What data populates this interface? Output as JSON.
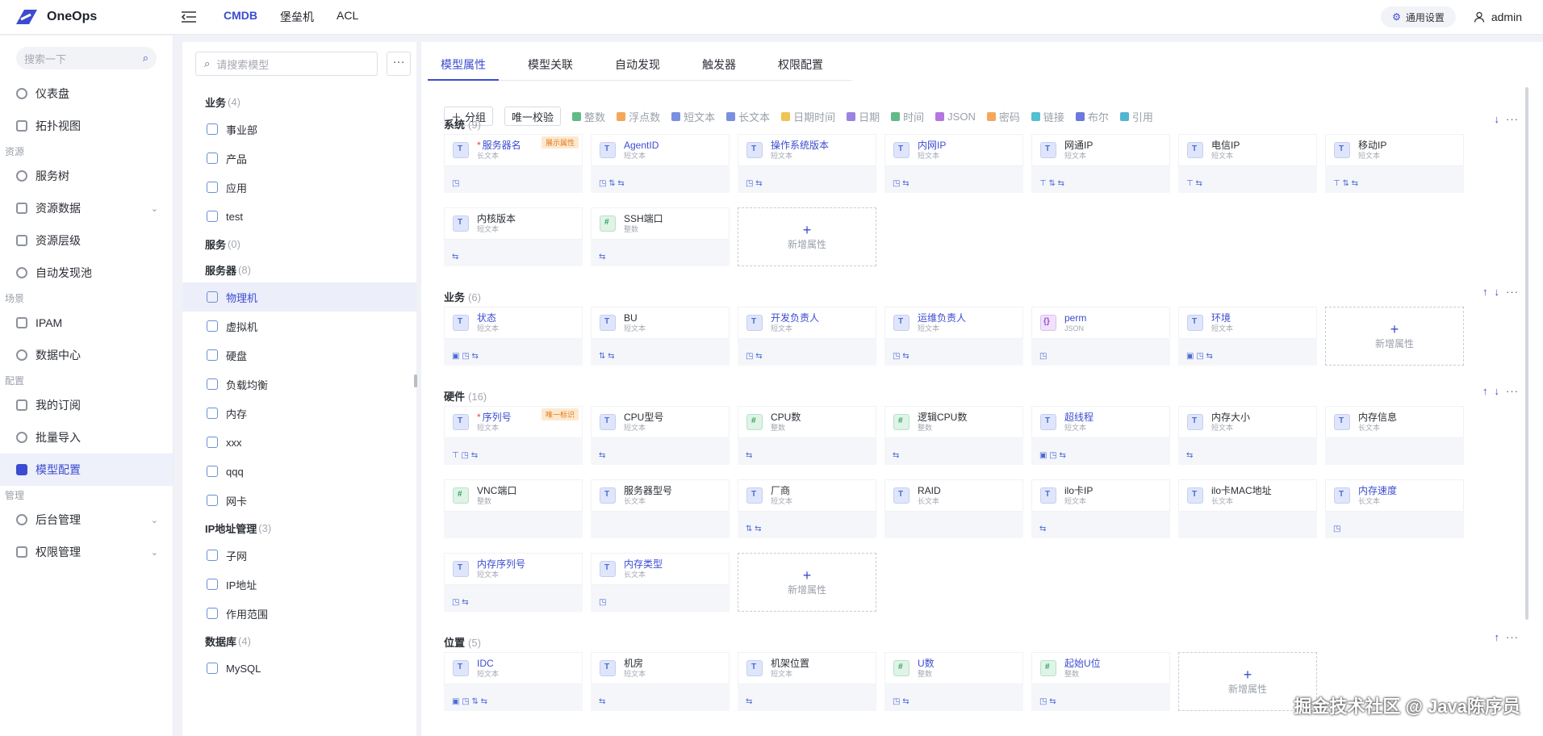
{
  "app": {
    "name": "OneOps"
  },
  "topnav": [
    {
      "label": "CMDB",
      "active": true
    },
    {
      "label": "堡垒机"
    },
    {
      "label": "ACL"
    }
  ],
  "header": {
    "settings_label": "通用设置",
    "user": "admin"
  },
  "sidebar": {
    "search_placeholder": "搜索一下",
    "items": [
      {
        "type": "item",
        "label": "仪表盘",
        "icon": "dashboard-icon"
      },
      {
        "type": "item",
        "label": "拓扑视图",
        "icon": "topology-icon"
      },
      {
        "type": "group",
        "label": "资源"
      },
      {
        "type": "item",
        "label": "服务树",
        "icon": "tree-icon"
      },
      {
        "type": "item",
        "label": "资源数据",
        "icon": "data-icon",
        "expand": true
      },
      {
        "type": "item",
        "label": "资源层级",
        "icon": "layers-icon"
      },
      {
        "type": "item",
        "label": "自动发现池",
        "icon": "discover-icon"
      },
      {
        "type": "group",
        "label": "场景"
      },
      {
        "type": "item",
        "label": "IPAM",
        "icon": "ipam-icon"
      },
      {
        "type": "item",
        "label": "数据中心",
        "icon": "datacenter-icon"
      },
      {
        "type": "group",
        "label": "配置"
      },
      {
        "type": "item",
        "label": "我的订阅",
        "icon": "bookmark-icon"
      },
      {
        "type": "item",
        "label": "批量导入",
        "icon": "import-icon"
      },
      {
        "type": "item",
        "label": "模型配置",
        "icon": "model-icon",
        "active": true
      },
      {
        "type": "group",
        "label": "管理"
      },
      {
        "type": "item",
        "label": "后台管理",
        "icon": "admin-icon",
        "expand": true
      },
      {
        "type": "item",
        "label": "权限管理",
        "icon": "shield-icon",
        "expand": true
      }
    ]
  },
  "tree": {
    "search_placeholder": "请搜索模型",
    "more": "···",
    "nodes": [
      {
        "type": "group",
        "label": "业务",
        "count": "(4)"
      },
      {
        "type": "item",
        "label": "事业部"
      },
      {
        "type": "item",
        "label": "产品"
      },
      {
        "type": "item",
        "label": "应用"
      },
      {
        "type": "item",
        "label": "test"
      },
      {
        "type": "group",
        "label": "服务",
        "count": "(0)"
      },
      {
        "type": "group",
        "label": "服务器",
        "count": "(8)"
      },
      {
        "type": "item",
        "label": "物理机",
        "selected": true
      },
      {
        "type": "item",
        "label": "虚拟机"
      },
      {
        "type": "item",
        "label": "硬盘"
      },
      {
        "type": "item",
        "label": "负载均衡"
      },
      {
        "type": "item",
        "label": "内存"
      },
      {
        "type": "item",
        "label": "xxx"
      },
      {
        "type": "item",
        "label": "qqq"
      },
      {
        "type": "item",
        "label": "网卡"
      },
      {
        "type": "group",
        "label": "IP地址管理",
        "count": "(3)"
      },
      {
        "type": "item",
        "label": "子网"
      },
      {
        "type": "item",
        "label": "IP地址"
      },
      {
        "type": "item",
        "label": "作用范围"
      },
      {
        "type": "group",
        "label": "数据库",
        "count": "(4)"
      },
      {
        "type": "item",
        "label": "MySQL"
      }
    ]
  },
  "tabs": [
    {
      "label": "模型属性",
      "active": true
    },
    {
      "label": "模型关联"
    },
    {
      "label": "自动发现"
    },
    {
      "label": "触发器"
    },
    {
      "label": "权限配置"
    }
  ],
  "toolbar": {
    "group_btn": "分组",
    "unique_btn": "唯一校验",
    "field_types": [
      {
        "label": "整数",
        "color": "#2ea35e"
      },
      {
        "label": "浮点数",
        "color": "#f08a24"
      },
      {
        "label": "短文本",
        "color": "#4c6bd6"
      },
      {
        "label": "长文本",
        "color": "#4c6bd6"
      },
      {
        "label": "日期时间",
        "color": "#e8b21c"
      },
      {
        "label": "日期",
        "color": "#7a5ad6"
      },
      {
        "label": "时间",
        "color": "#2ea35e"
      },
      {
        "label": "JSON",
        "color": "#9b4ad6"
      },
      {
        "label": "密码",
        "color": "#f08a24"
      },
      {
        "label": "链接",
        "color": "#1aa9c1"
      },
      {
        "label": "布尔",
        "color": "#3b4cd0"
      },
      {
        "label": "引用",
        "color": "#1a9ec1"
      }
    ]
  },
  "add_label": "新增属性",
  "sections": [
    {
      "name": "系统",
      "count": "(9)",
      "up": false,
      "down": true,
      "fields": [
        {
          "name": "服务器名",
          "type": "长文本",
          "required": true,
          "badge": "展示属性",
          "blue": true,
          "icons": "◳"
        },
        {
          "name": "AgentID",
          "type": "短文本",
          "blue": true,
          "icons": "◳ ⇅ ⇆"
        },
        {
          "name": "操作系统版本",
          "type": "短文本",
          "blue": true,
          "icons": "◳ ⇆"
        },
        {
          "name": "内网IP",
          "type": "短文本",
          "blue": true,
          "icons": "◳ ⇆"
        },
        {
          "name": "网通IP",
          "type": "短文本",
          "icons": "⊤ ⇅ ⇆"
        },
        {
          "name": "电信IP",
          "type": "短文本",
          "icons": "⊤ ⇆"
        },
        {
          "name": "移动IP",
          "type": "短文本",
          "icons": "⊤ ⇅ ⇆"
        },
        {
          "name": "内核版本",
          "type": "短文本",
          "icons": "⇆"
        },
        {
          "name": "SSH端口",
          "type": "整数",
          "kind": "num",
          "icons": "⇆"
        }
      ]
    },
    {
      "name": "业务",
      "count": "(6)",
      "up": true,
      "down": true,
      "fields": [
        {
          "name": "状态",
          "type": "短文本",
          "blue": true,
          "icons": "▣ ◳ ⇆"
        },
        {
          "name": "BU",
          "type": "短文本",
          "icons": "⇅ ⇆"
        },
        {
          "name": "开发负责人",
          "type": "短文本",
          "blue": true,
          "icons": "◳ ⇆"
        },
        {
          "name": "运维负责人",
          "type": "短文本",
          "blue": true,
          "icons": "◳ ⇆"
        },
        {
          "name": "perm",
          "type": "JSON",
          "kind": "json",
          "blue": true,
          "icons": "◳"
        },
        {
          "name": "环境",
          "type": "短文本",
          "blue": true,
          "icons": "▣ ◳ ⇆"
        }
      ]
    },
    {
      "name": "硬件",
      "count": "(16)",
      "up": true,
      "down": true,
      "fields": [
        {
          "name": "序列号",
          "type": "短文本",
          "required": true,
          "badge": "唯一标识",
          "blue": true,
          "icons": "⊤ ◳ ⇆"
        },
        {
          "name": "CPU型号",
          "type": "短文本",
          "icons": "⇆"
        },
        {
          "name": "CPU数",
          "type": "整数",
          "kind": "num",
          "icons": "⇆"
        },
        {
          "name": "逻辑CPU数",
          "type": "整数",
          "kind": "num",
          "icons": "⇆"
        },
        {
          "name": "超线程",
          "type": "短文本",
          "blue": true,
          "icons": "▣ ◳ ⇆"
        },
        {
          "name": "内存大小",
          "type": "短文本",
          "icons": "⇆"
        },
        {
          "name": "内存信息",
          "type": "长文本",
          "icons": ""
        },
        {
          "name": "VNC端口",
          "type": "整数",
          "kind": "num",
          "icons": ""
        },
        {
          "name": "服务器型号",
          "type": "长文本",
          "icons": ""
        },
        {
          "name": "厂商",
          "type": "短文本",
          "icons": "⇅ ⇆"
        },
        {
          "name": "RAID",
          "type": "长文本",
          "icons": ""
        },
        {
          "name": "ilo卡IP",
          "type": "短文本",
          "icons": "⇆"
        },
        {
          "name": "ilo卡MAC地址",
          "type": "长文本",
          "icons": ""
        },
        {
          "name": "内存速度",
          "type": "长文本",
          "blue": true,
          "icons": "◳"
        },
        {
          "name": "内存序列号",
          "type": "短文本",
          "blue": true,
          "icons": "◳ ⇆"
        },
        {
          "name": "内存类型",
          "type": "长文本",
          "blue": true,
          "icons": "◳"
        }
      ]
    },
    {
      "name": "位置",
      "count": "(5)",
      "up": true,
      "down": false,
      "fields": [
        {
          "name": "IDC",
          "type": "短文本",
          "blue": true,
          "icons": "▣ ◳ ⇅ ⇆"
        },
        {
          "name": "机房",
          "type": "短文本",
          "icons": "⇆"
        },
        {
          "name": "机架位置",
          "type": "短文本",
          "icons": "⇆"
        },
        {
          "name": "U数",
          "type": "整数",
          "kind": "num",
          "blue": true,
          "icons": "◳ ⇆"
        },
        {
          "name": "起始U位",
          "type": "整数",
          "kind": "num",
          "blue": true,
          "icons": "◳ ⇆"
        }
      ]
    }
  ],
  "watermark": "掘金技术社区 @ Java陈序员"
}
